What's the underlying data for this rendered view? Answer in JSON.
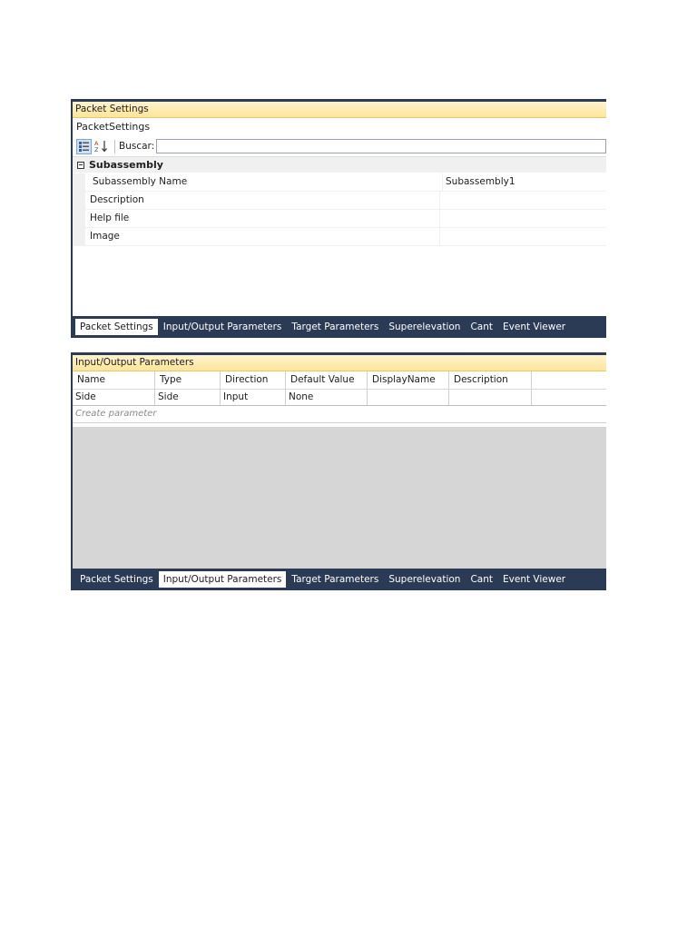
{
  "tabs": [
    "Packet Settings",
    "Input/Output Parameters",
    "Target Parameters",
    "Superelevation",
    "Cant",
    "Event Viewer"
  ],
  "panel1": {
    "title": "Packet Settings",
    "subtitle": "PacketSettings",
    "search_label": "Buscar:",
    "search_value": "",
    "category": "Subassembly",
    "properties": [
      {
        "name": "Subassembly Name",
        "value": "Subassembly1"
      },
      {
        "name": "Description",
        "value": ""
      },
      {
        "name": "Help file",
        "value": ""
      },
      {
        "name": "Image",
        "value": ""
      }
    ],
    "active_tab": "Packet Settings"
  },
  "panel2": {
    "title": "Input/Output Parameters",
    "columns": [
      "Name",
      "Type",
      "Direction",
      "Default Value",
      "DisplayName",
      "Description"
    ],
    "rows": [
      [
        "Side",
        "Side",
        "Input",
        "None",
        "",
        ""
      ]
    ],
    "create_placeholder": "Create parameter",
    "active_tab": "Input/Output Parameters"
  },
  "colors": {
    "tabbar": "#2b3a55",
    "title_bar": "#fde59a",
    "empty_area": "#d6d6d6"
  },
  "icons": [
    "categorized-icon",
    "sort-alpha-icon"
  ]
}
